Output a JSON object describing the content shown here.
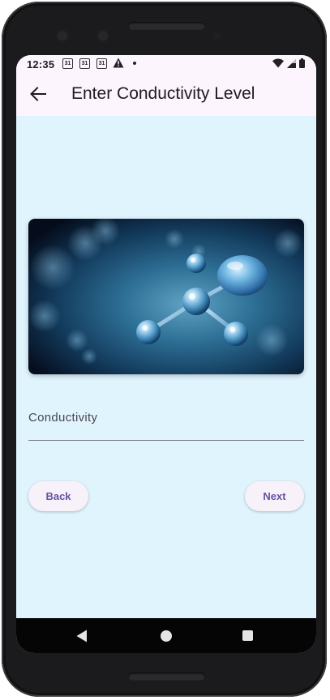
{
  "status_bar": {
    "time": "12:35",
    "calendar_day": "31",
    "icons": [
      "calendar-icon",
      "calendar-icon",
      "calendar-icon",
      "warning-icon",
      "dot-icon",
      "wifi-icon",
      "signal-icon",
      "battery-icon"
    ]
  },
  "app_bar": {
    "back_icon": "arrow-left-icon",
    "title": "Enter Conductivity Level"
  },
  "hero_image": {
    "subject": "molecule-illustration"
  },
  "form": {
    "conductivity_label": "Conductivity",
    "conductivity_value": ""
  },
  "buttons": {
    "back_label": "Back",
    "next_label": "Next"
  },
  "navigation_bar": {
    "icons": [
      "nav-back-icon",
      "nav-home-icon",
      "nav-recents-icon"
    ]
  },
  "colors": {
    "background": "#e0f4fd",
    "app_bar": "#fdf5fe",
    "accent": "#6750a4",
    "button_surface": "#f7f2fa"
  }
}
